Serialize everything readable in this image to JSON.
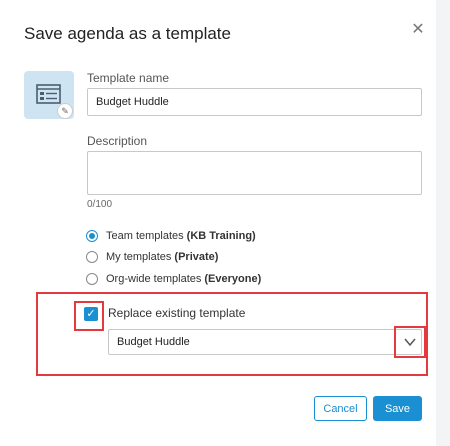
{
  "dialog": {
    "title": "Save agenda as a template",
    "close_icon": "close-icon"
  },
  "template_icon": {
    "icon": "template-icon",
    "badge_icon": "pencil-icon"
  },
  "fields": {
    "name_label": "Template name",
    "name_value": "Budget Huddle",
    "description_label": "Description",
    "description_value": "",
    "char_counter": "0/100"
  },
  "radios": [
    {
      "label": "Team templates",
      "emphasis": "(KB Training)",
      "checked": true
    },
    {
      "label": "My templates",
      "emphasis": "(Private)",
      "checked": false
    },
    {
      "label": "Org-wide templates",
      "emphasis": "(Everyone)",
      "checked": false
    }
  ],
  "replace": {
    "checkbox_label": "Replace existing template",
    "checked": true,
    "selected_template": "Budget Huddle"
  },
  "buttons": {
    "cancel": "Cancel",
    "save": "Save"
  },
  "colors": {
    "accent": "#1a8fd1",
    "highlight": "#e3393f",
    "icon_bg": "#cfe4f3"
  }
}
